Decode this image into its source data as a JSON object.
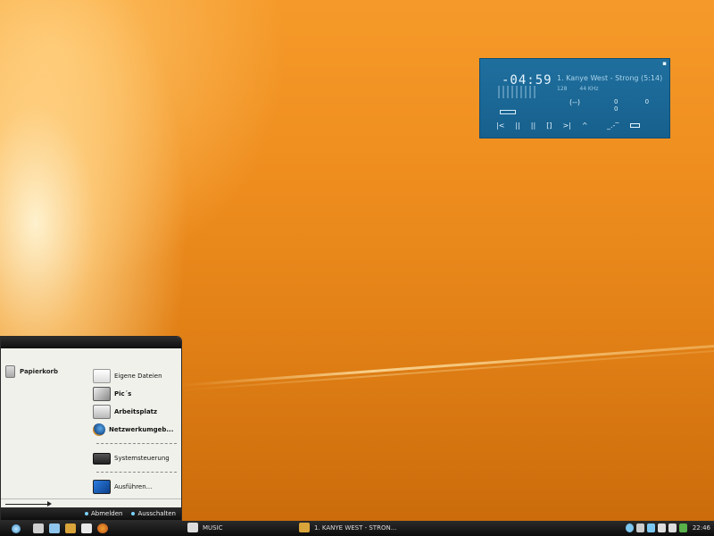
{
  "player": {
    "time": "-04:59",
    "track": "1. Kanye West - Strong (5:14)",
    "info": [
      "128",
      "44 KHz"
    ],
    "eq": "(--)",
    "dots": "0 0 0",
    "controls": [
      "|<",
      "||",
      "||",
      "[]",
      ">|",
      "^"
    ],
    "vol": "_.-‾"
  },
  "startmenu": {
    "left_item": "Papierkorb",
    "right_items": [
      {
        "label": "Eigene Dateien",
        "icon": "documents-icon",
        "bold": false
      },
      {
        "label": "Pic´s",
        "icon": "pictures-icon",
        "bold": true
      },
      {
        "label": "Arbeitsplatz",
        "icon": "computer-icon",
        "bold": true
      },
      {
        "label": "Netzwerkumgeb...",
        "icon": "network-icon",
        "bold": true
      },
      {
        "label": "Systemsteuerung",
        "icon": "control-panel-icon",
        "bold": false
      },
      {
        "label": "Ausführen...",
        "icon": "run-icon",
        "bold": false
      }
    ],
    "logoff": "Abmelden",
    "shutdown": "Ausschalten"
  },
  "taskbar": {
    "task_music": "MUSIC",
    "task_player": "1. KANYE WEST - STRON...",
    "clock": "22:46"
  },
  "colors": {
    "player_bg": "#1f6f9e",
    "menu_bg": "#f1f1ec",
    "taskbar": "#1a1a1a"
  }
}
